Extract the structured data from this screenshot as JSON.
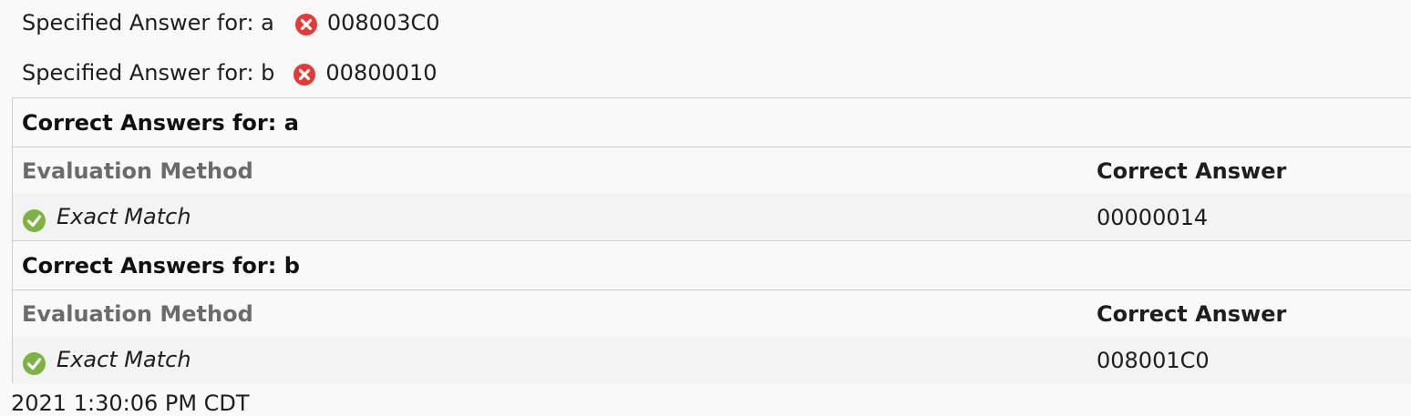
{
  "specified": [
    {
      "label": "Specified Answer for: a",
      "status_icon": "incorrect-icon",
      "value": "008003C0"
    },
    {
      "label": "Specified Answer for: b",
      "status_icon": "incorrect-icon",
      "value": "00800010"
    }
  ],
  "correct_answers": [
    {
      "title": "Correct Answers for: a",
      "columns": {
        "method": "Evaluation Method",
        "answer": "Correct Answer"
      },
      "row": {
        "status_icon": "correct-icon",
        "method": "Exact Match",
        "answer": "00000014"
      }
    },
    {
      "title": "Correct Answers for: b",
      "columns": {
        "method": "Evaluation Method",
        "answer": "Correct Answer"
      },
      "row": {
        "status_icon": "correct-icon",
        "method": "Exact Match",
        "answer": "008001C0"
      }
    }
  ],
  "footer": {
    "timestamp": "2021 1:30:06 PM CDT"
  },
  "colors": {
    "incorrect": "#e53935",
    "correct": "#7cb342",
    "muted_header": "#6b6b6b",
    "border": "#cfcfcf"
  }
}
